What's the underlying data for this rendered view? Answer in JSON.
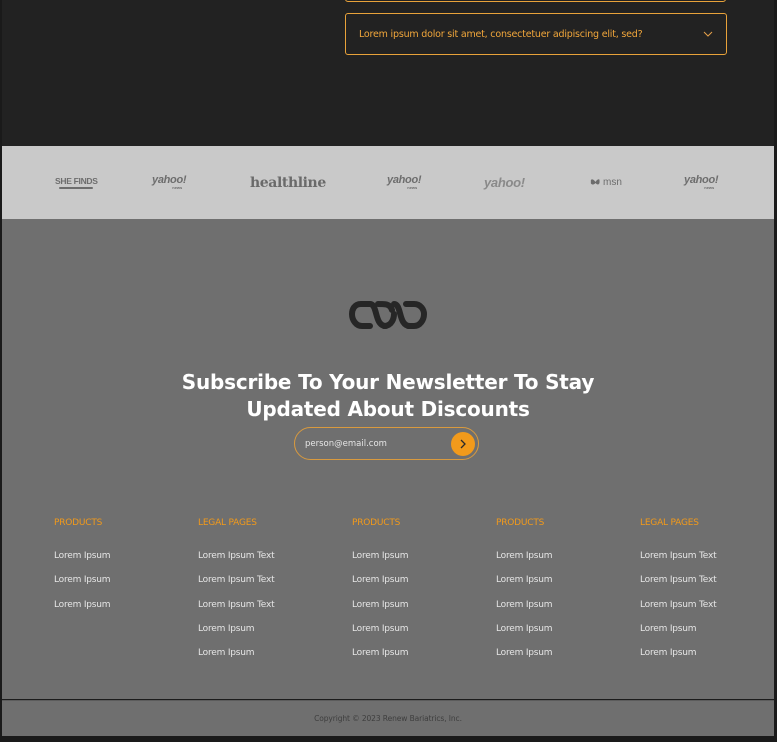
{
  "faq": {
    "question": "Lorem ipsum dolor sit amet, consectetuer adipiscing elit, sed?"
  },
  "press_logos": [
    {
      "name": "SHE FINDS",
      "subtext": ""
    },
    {
      "name": "yahoo!",
      "subtext": "news"
    },
    {
      "name": "healthline",
      "subtext": ""
    },
    {
      "name": "yahoo!",
      "subtext": "news"
    },
    {
      "name": "yahoo!",
      "subtext": ""
    },
    {
      "name": "msn",
      "subtext": ""
    },
    {
      "name": "yahoo!",
      "subtext": "news"
    }
  ],
  "newsletter": {
    "heading_line1": "Subscribe To Your Newsletter To Stay",
    "heading_line2": "Updated About Discounts",
    "email_placeholder": "person@email.com"
  },
  "footer_columns": [
    {
      "heading": "PRODUCTS",
      "links": [
        "Lorem Ipsum",
        "Lorem Ipsum",
        "Lorem Ipsum"
      ]
    },
    {
      "heading": "LEGAL PAGES",
      "links": [
        "Lorem Ipsum Text",
        "Lorem Ipsum Text",
        "Lorem Ipsum Text",
        "Lorem Ipsum",
        "Lorem Ipsum"
      ]
    },
    {
      "heading": "PRODUCTS",
      "links": [
        "Lorem Ipsum",
        "Lorem Ipsum",
        "Lorem Ipsum",
        "Lorem Ipsum",
        "Lorem Ipsum"
      ]
    },
    {
      "heading": "PRODUCTS",
      "links": [
        "Lorem Ipsum",
        "Lorem Ipsum",
        "Lorem Ipsum",
        "Lorem Ipsum",
        "Lorem Ipsum"
      ]
    },
    {
      "heading": "LEGAL PAGES",
      "links": [
        "Lorem Ipsum Text",
        "Lorem Ipsum Text",
        "Lorem Ipsum Text",
        "Lorem Ipsum",
        "Lorem Ipsum"
      ]
    }
  ],
  "copyright": "Copyright © 2023 Renew Bariatrics, Inc.",
  "icons": {
    "faq_toggle": "chevron-down-icon",
    "submit": "chevron-right-icon",
    "brand": "brand-logo-icon"
  },
  "colors": {
    "accent": "#f29a1b",
    "border_accent": "#e8a23a",
    "dark_bg": "#222222",
    "strip_bg": "#c9c9c9",
    "footer_bg": "#6f6f6f"
  }
}
